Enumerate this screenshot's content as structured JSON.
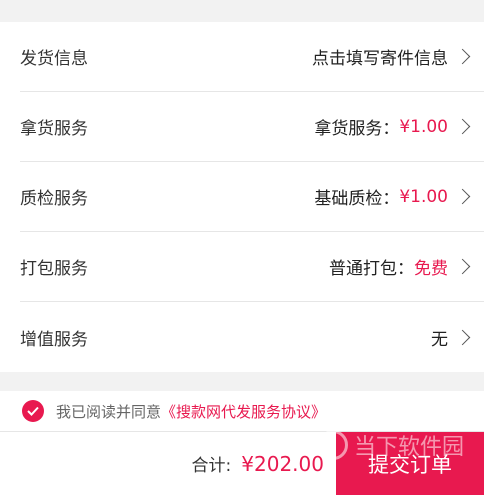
{
  "rows": [
    {
      "label": "发货信息",
      "prefix": "点击填写寄件信息",
      "value": ""
    },
    {
      "label": "拿货服务",
      "prefix": "拿货服务：",
      "value": "¥1.00"
    },
    {
      "label": "质检服务",
      "prefix": "基础质检：",
      "value": "¥1.00"
    },
    {
      "label": "打包服务",
      "prefix": "普通打包：",
      "value": "免费"
    },
    {
      "label": "增值服务",
      "prefix": "无",
      "value": ""
    }
  ],
  "agreement": {
    "text": "我已阅读并同意",
    "link": "《搜款网代发服务协议》",
    "checked": true
  },
  "footer": {
    "total_label": "合计:",
    "total_value": "¥202.00",
    "submit_label": "提交订单"
  },
  "watermark": {
    "text": "当下软件园"
  },
  "colors": {
    "accent": "#e8194f",
    "background": "#f2f2f2"
  }
}
